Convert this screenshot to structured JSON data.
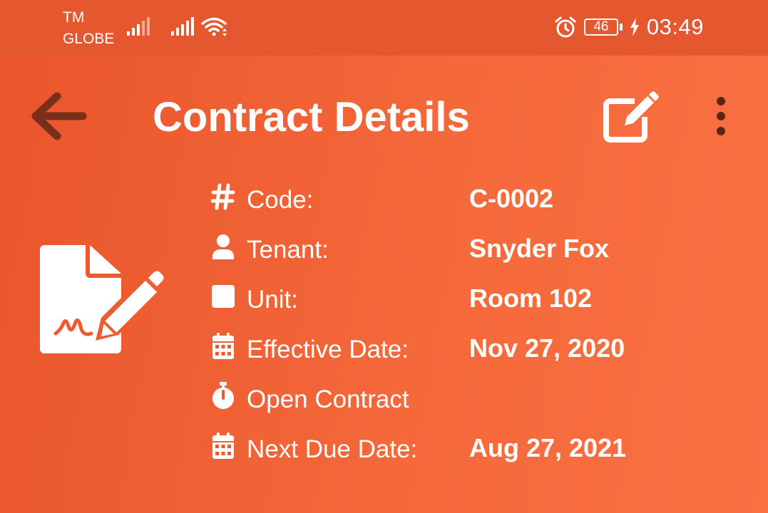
{
  "status_bar": {
    "carrier_line1": "TM",
    "carrier_line2": "GLOBE",
    "battery": "46",
    "time": "03:49",
    "icons": [
      "signal-icon",
      "signal-icon",
      "wifi-icon",
      "alarm-icon",
      "battery-icon",
      "charging-icon"
    ]
  },
  "app_bar": {
    "title": "Contract Details",
    "back_icon": "arrow-left-icon",
    "edit_icon": "edit-icon",
    "more_icon": "more-vertical-icon"
  },
  "contract_icon": "file-signature-icon",
  "details": [
    {
      "icon": "hash-icon",
      "label": "Code:",
      "value": "C-0002"
    },
    {
      "icon": "user-icon",
      "label": "Tenant:",
      "value": "Snyder Fox"
    },
    {
      "icon": "square-icon",
      "label": "Unit:",
      "value": "Room 102"
    },
    {
      "icon": "calendar-icon",
      "label": "Effective Date:",
      "value": "Nov 27, 2020"
    },
    {
      "icon": "stopwatch-icon",
      "label": "Open Contract",
      "value": ""
    },
    {
      "icon": "calendar-icon",
      "label": "Next Due Date:",
      "value": "Aug 27, 2021"
    }
  ],
  "colors": {
    "background": "#f0592e",
    "status_bar": "#e5572f",
    "back_arrow": "#7a2f1a",
    "text": "#ffffff"
  }
}
